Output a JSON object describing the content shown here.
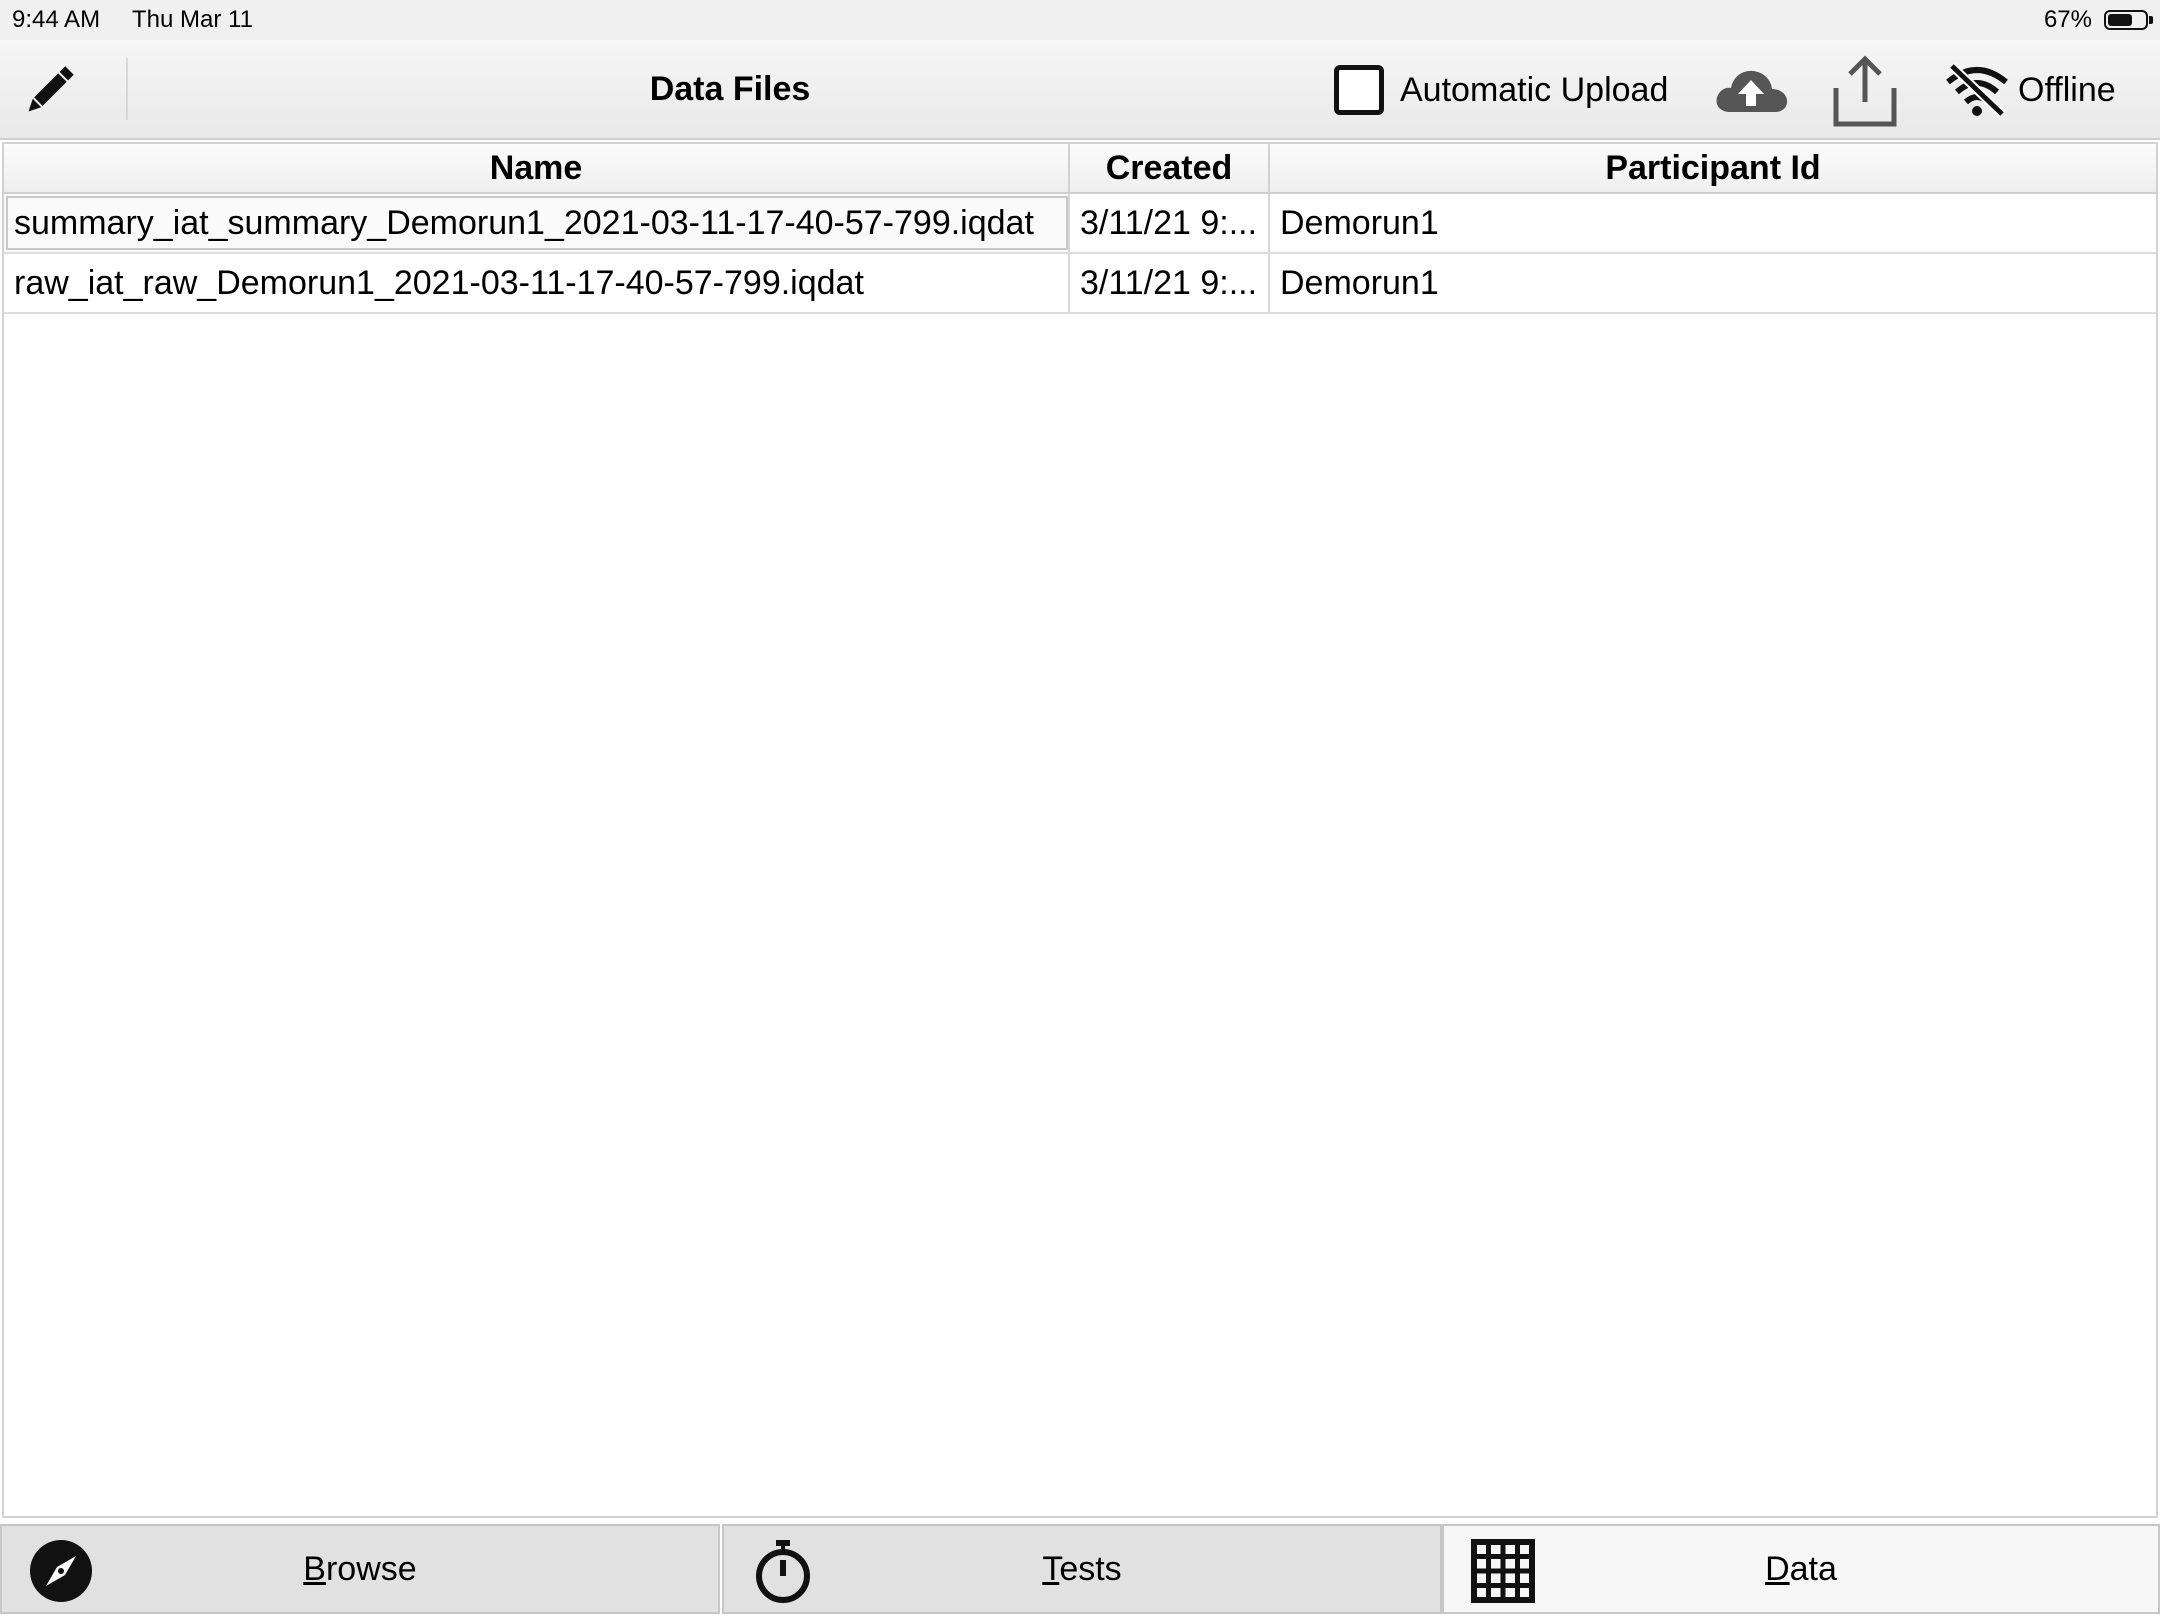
{
  "status_bar": {
    "time": "9:44 AM",
    "date": "Thu Mar 11",
    "battery_pct_label": "67%",
    "battery_level": 0.67
  },
  "toolbar": {
    "edit_icon": "pencil-icon",
    "title": "Data Files",
    "auto_upload_label": "Automatic Upload",
    "auto_upload_checked": false,
    "upload_icon": "cloud-upload-icon",
    "share_icon": "share-icon",
    "offline_icon": "wifi-off-icon",
    "offline_label": "Offline"
  },
  "table": {
    "columns": [
      "Name",
      "Created",
      "Participant Id"
    ],
    "rows": [
      {
        "name": "summary_iat_summary_Demorun1_2021-03-11-17-40-57-799.iqdat",
        "created": "3/11/21 9:...",
        "participant_id": "Demorun1"
      },
      {
        "name": "raw_iat_raw_Demorun1_2021-03-11-17-40-57-799.iqdat",
        "created": "3/11/21 9:...",
        "participant_id": "Demorun1"
      }
    ]
  },
  "tabs": [
    {
      "first": "B",
      "rest": "rowse",
      "icon": "compass-icon",
      "active": false
    },
    {
      "first": "T",
      "rest": "ests",
      "icon": "stopwatch-icon",
      "active": false
    },
    {
      "first": "D",
      "rest": "ata",
      "icon": "grid-icon",
      "active": true
    }
  ],
  "colors": {
    "text": "#000000",
    "icon": "#111111",
    "cloud_icon": "#555555",
    "tab_bg": "#e1e1e1",
    "tab_active_bg": "#f7f7f7"
  }
}
